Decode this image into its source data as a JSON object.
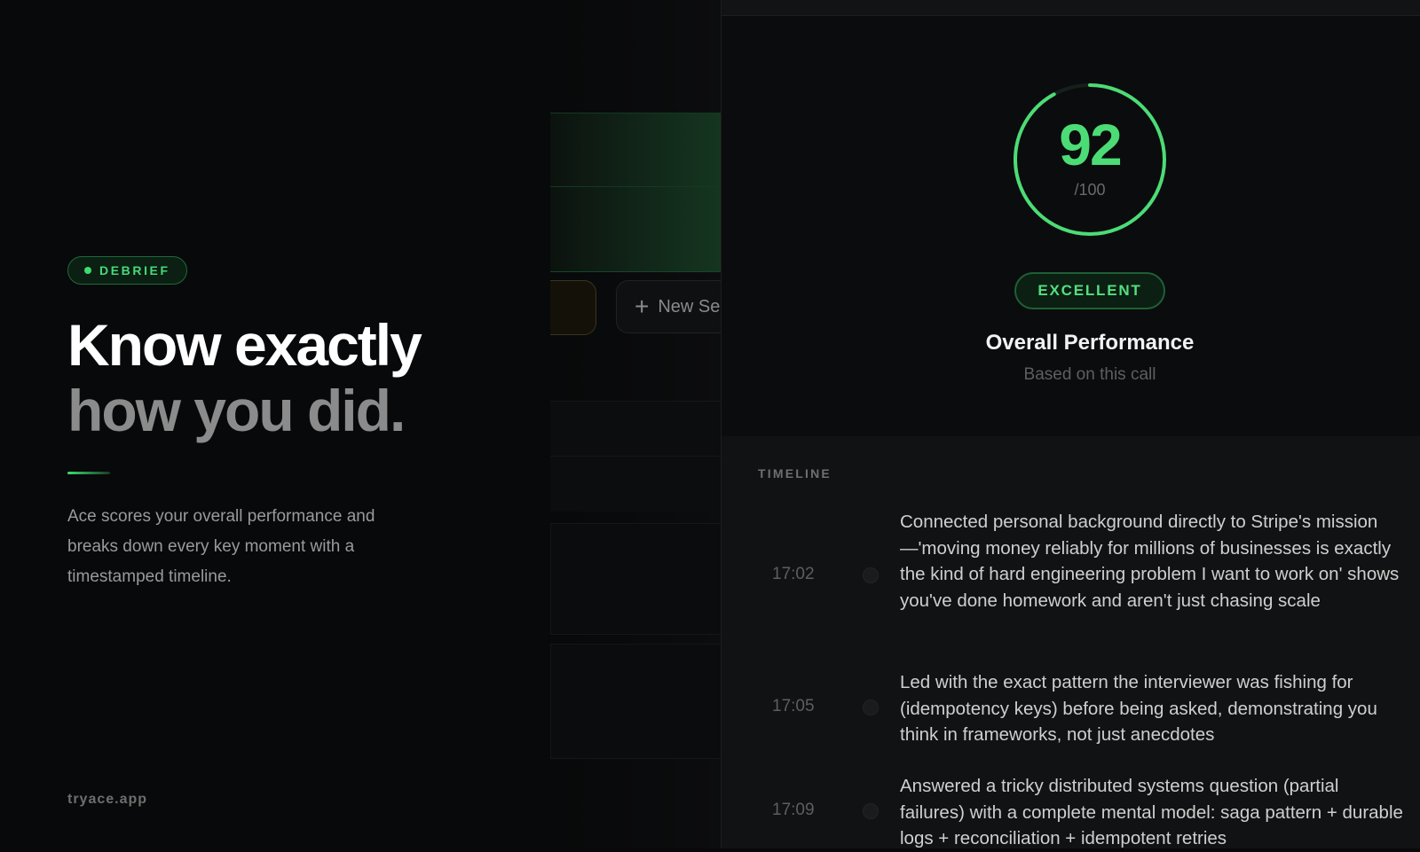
{
  "badge": {
    "label": "DEBRIEF",
    "color": "#3ddc6f"
  },
  "headline": {
    "line1": "Know exactly",
    "line2": "how you did."
  },
  "description": "Ace scores your overall performance and breaks down every key moment with a timestamped timeline.",
  "footer": {
    "url": "tryace.app"
  },
  "background_app": {
    "new_session_label": "New Se"
  },
  "score": {
    "value": "92",
    "denominator": "/100",
    "fraction": 0.92,
    "rating": "EXCELLENT",
    "title": "Overall Performance",
    "subtitle": "Based on this call",
    "accent_color": "#4cdc76"
  },
  "timeline": {
    "label": "TIMELINE",
    "items": [
      {
        "time": "17:02",
        "text": "Connected personal background directly to Stripe's mission—'moving money reliably for millions of businesses is exactly the kind of hard engineering problem I want to work on' shows you've done homework and aren't just chasing scale"
      },
      {
        "time": "17:05",
        "text": "Led with the exact pattern the interviewer was fishing for (idempotency keys) before being asked, demonstrating you think in frameworks, not just anecdotes"
      },
      {
        "time": "17:09",
        "text": "Answered a tricky distributed systems question (partial failures) with a complete mental model: saga pattern + durable logs + reconciliation + idempotent retries"
      }
    ]
  }
}
